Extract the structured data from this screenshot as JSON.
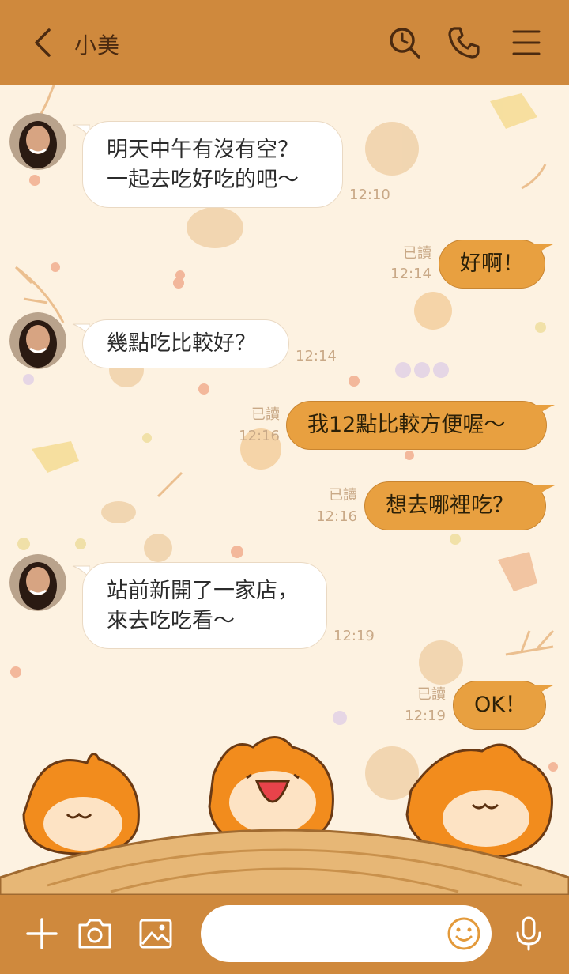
{
  "header": {
    "contact_name": "小美",
    "icons": [
      "back-chevron-icon",
      "search-clock-icon",
      "phone-icon",
      "menu-icon"
    ]
  },
  "messages": [
    {
      "side": "in",
      "lines": [
        "明天中午有沒有空？",
        "一起去吃好吃的吧～"
      ],
      "time": "12:10"
    },
    {
      "side": "out",
      "lines": [
        "好啊！"
      ],
      "read": "已讀",
      "time": "12:14"
    },
    {
      "side": "in",
      "lines": [
        "幾點吃比較好？"
      ],
      "time": "12:14"
    },
    {
      "side": "out",
      "lines": [
        "我12點比較方便喔～"
      ],
      "read": "已讀",
      "time": "12:16"
    },
    {
      "side": "out",
      "lines": [
        "想去哪裡吃？"
      ],
      "read": "已讀",
      "time": "12:16"
    },
    {
      "side": "in",
      "lines": [
        "站前新開了一家店，",
        "來去吃吃看～"
      ],
      "time": "12:19"
    },
    {
      "side": "out",
      "lines": [
        "OK！"
      ],
      "read": "已讀",
      "time": "12:19"
    }
  ],
  "input": {
    "placeholder": "",
    "icons": [
      "plus-icon",
      "camera-icon",
      "image-icon",
      "emoji-icon",
      "microphone-icon"
    ]
  },
  "colors": {
    "header": "#cf893d",
    "background": "#fdf2e1",
    "outgoing_bubble": "#e8a040",
    "incoming_bubble": "#ffffff"
  }
}
